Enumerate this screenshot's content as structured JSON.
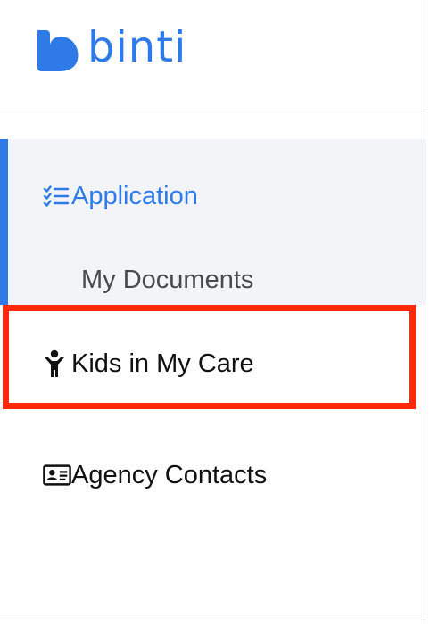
{
  "brand": {
    "name": "binti",
    "color": "#2e7be8",
    "logo_icon": "heart-logo-icon"
  },
  "nav": {
    "items": [
      {
        "label": "Application",
        "icon": "checklist-icon",
        "active": true
      },
      {
        "label": "My Documents",
        "icon": "",
        "active": false
      },
      {
        "label": "Kids in My Care",
        "icon": "child-icon",
        "active": false,
        "highlighted": true
      },
      {
        "label": "Agency Contacts",
        "icon": "contact-card-icon",
        "active": false
      }
    ]
  },
  "colors": {
    "accent": "#2e7be8",
    "highlight_border": "#ff2a0c",
    "section_background": "#f3f4f7"
  }
}
